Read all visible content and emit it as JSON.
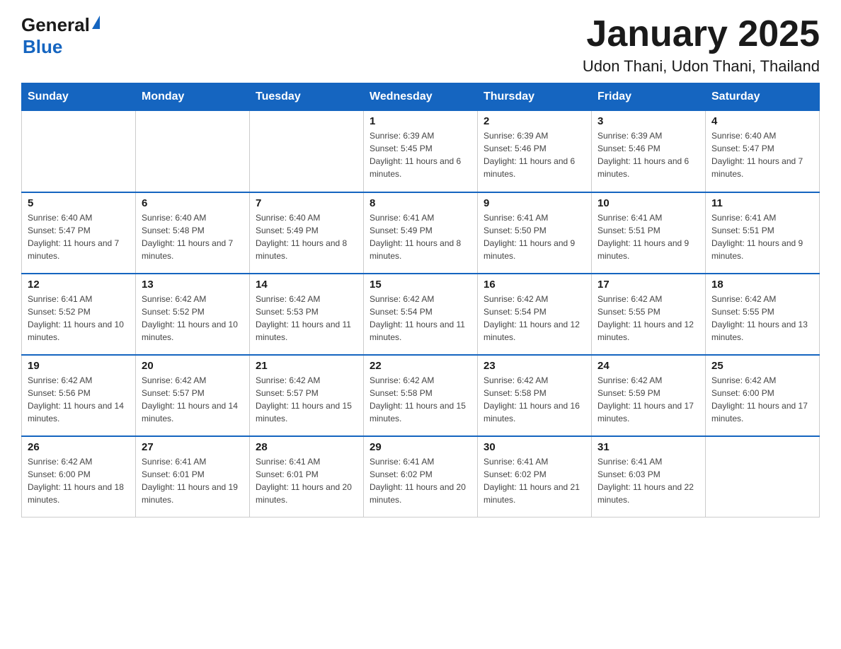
{
  "header": {
    "month_title": "January 2025",
    "location": "Udon Thani, Udon Thani, Thailand",
    "logo_general": "General",
    "logo_blue": "Blue"
  },
  "weekdays": [
    "Sunday",
    "Monday",
    "Tuesday",
    "Wednesday",
    "Thursday",
    "Friday",
    "Saturday"
  ],
  "weeks": [
    [
      {
        "day": "",
        "info": ""
      },
      {
        "day": "",
        "info": ""
      },
      {
        "day": "",
        "info": ""
      },
      {
        "day": "1",
        "info": "Sunrise: 6:39 AM\nSunset: 5:45 PM\nDaylight: 11 hours and 6 minutes."
      },
      {
        "day": "2",
        "info": "Sunrise: 6:39 AM\nSunset: 5:46 PM\nDaylight: 11 hours and 6 minutes."
      },
      {
        "day": "3",
        "info": "Sunrise: 6:39 AM\nSunset: 5:46 PM\nDaylight: 11 hours and 6 minutes."
      },
      {
        "day": "4",
        "info": "Sunrise: 6:40 AM\nSunset: 5:47 PM\nDaylight: 11 hours and 7 minutes."
      }
    ],
    [
      {
        "day": "5",
        "info": "Sunrise: 6:40 AM\nSunset: 5:47 PM\nDaylight: 11 hours and 7 minutes."
      },
      {
        "day": "6",
        "info": "Sunrise: 6:40 AM\nSunset: 5:48 PM\nDaylight: 11 hours and 7 minutes."
      },
      {
        "day": "7",
        "info": "Sunrise: 6:40 AM\nSunset: 5:49 PM\nDaylight: 11 hours and 8 minutes."
      },
      {
        "day": "8",
        "info": "Sunrise: 6:41 AM\nSunset: 5:49 PM\nDaylight: 11 hours and 8 minutes."
      },
      {
        "day": "9",
        "info": "Sunrise: 6:41 AM\nSunset: 5:50 PM\nDaylight: 11 hours and 9 minutes."
      },
      {
        "day": "10",
        "info": "Sunrise: 6:41 AM\nSunset: 5:51 PM\nDaylight: 11 hours and 9 minutes."
      },
      {
        "day": "11",
        "info": "Sunrise: 6:41 AM\nSunset: 5:51 PM\nDaylight: 11 hours and 9 minutes."
      }
    ],
    [
      {
        "day": "12",
        "info": "Sunrise: 6:41 AM\nSunset: 5:52 PM\nDaylight: 11 hours and 10 minutes."
      },
      {
        "day": "13",
        "info": "Sunrise: 6:42 AM\nSunset: 5:52 PM\nDaylight: 11 hours and 10 minutes."
      },
      {
        "day": "14",
        "info": "Sunrise: 6:42 AM\nSunset: 5:53 PM\nDaylight: 11 hours and 11 minutes."
      },
      {
        "day": "15",
        "info": "Sunrise: 6:42 AM\nSunset: 5:54 PM\nDaylight: 11 hours and 11 minutes."
      },
      {
        "day": "16",
        "info": "Sunrise: 6:42 AM\nSunset: 5:54 PM\nDaylight: 11 hours and 12 minutes."
      },
      {
        "day": "17",
        "info": "Sunrise: 6:42 AM\nSunset: 5:55 PM\nDaylight: 11 hours and 12 minutes."
      },
      {
        "day": "18",
        "info": "Sunrise: 6:42 AM\nSunset: 5:55 PM\nDaylight: 11 hours and 13 minutes."
      }
    ],
    [
      {
        "day": "19",
        "info": "Sunrise: 6:42 AM\nSunset: 5:56 PM\nDaylight: 11 hours and 14 minutes."
      },
      {
        "day": "20",
        "info": "Sunrise: 6:42 AM\nSunset: 5:57 PM\nDaylight: 11 hours and 14 minutes."
      },
      {
        "day": "21",
        "info": "Sunrise: 6:42 AM\nSunset: 5:57 PM\nDaylight: 11 hours and 15 minutes."
      },
      {
        "day": "22",
        "info": "Sunrise: 6:42 AM\nSunset: 5:58 PM\nDaylight: 11 hours and 15 minutes."
      },
      {
        "day": "23",
        "info": "Sunrise: 6:42 AM\nSunset: 5:58 PM\nDaylight: 11 hours and 16 minutes."
      },
      {
        "day": "24",
        "info": "Sunrise: 6:42 AM\nSunset: 5:59 PM\nDaylight: 11 hours and 17 minutes."
      },
      {
        "day": "25",
        "info": "Sunrise: 6:42 AM\nSunset: 6:00 PM\nDaylight: 11 hours and 17 minutes."
      }
    ],
    [
      {
        "day": "26",
        "info": "Sunrise: 6:42 AM\nSunset: 6:00 PM\nDaylight: 11 hours and 18 minutes."
      },
      {
        "day": "27",
        "info": "Sunrise: 6:41 AM\nSunset: 6:01 PM\nDaylight: 11 hours and 19 minutes."
      },
      {
        "day": "28",
        "info": "Sunrise: 6:41 AM\nSunset: 6:01 PM\nDaylight: 11 hours and 20 minutes."
      },
      {
        "day": "29",
        "info": "Sunrise: 6:41 AM\nSunset: 6:02 PM\nDaylight: 11 hours and 20 minutes."
      },
      {
        "day": "30",
        "info": "Sunrise: 6:41 AM\nSunset: 6:02 PM\nDaylight: 11 hours and 21 minutes."
      },
      {
        "day": "31",
        "info": "Sunrise: 6:41 AM\nSunset: 6:03 PM\nDaylight: 11 hours and 22 minutes."
      },
      {
        "day": "",
        "info": ""
      }
    ]
  ]
}
